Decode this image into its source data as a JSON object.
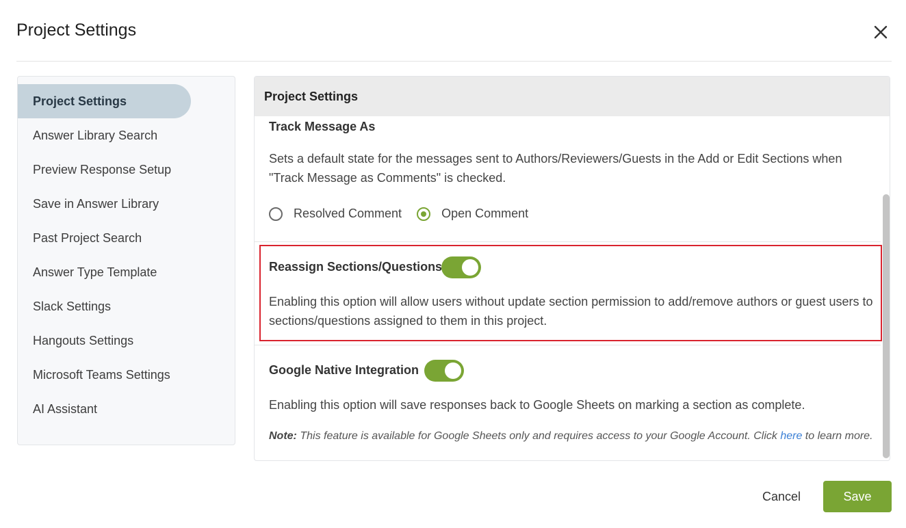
{
  "dialog": {
    "title": "Project Settings",
    "close_icon": "close-icon"
  },
  "sidebar": {
    "items": [
      {
        "label": "Project Settings",
        "active": true
      },
      {
        "label": "Answer Library Search"
      },
      {
        "label": "Preview Response Setup"
      },
      {
        "label": "Save in Answer Library"
      },
      {
        "label": "Past Project Search"
      },
      {
        "label": "Answer Type Template"
      },
      {
        "label": "Slack Settings"
      },
      {
        "label": "Hangouts Settings"
      },
      {
        "label": "Microsoft Teams Settings"
      },
      {
        "label": "AI Assistant"
      }
    ]
  },
  "panel": {
    "header": "Project Settings",
    "track_message": {
      "title": "Track Message As",
      "description": "Sets a default state for the messages sent to Authors/Reviewers/Guests in the Add or Edit Sections when \"Track Message as Comments\" is checked.",
      "options": [
        "Resolved Comment",
        "Open Comment"
      ],
      "selected": "Open Comment"
    },
    "reassign": {
      "title": "Reassign Sections/Questions",
      "enabled": true,
      "description": "Enabling this option will allow users without update section permission to add/remove authors or guest users to sections/questions assigned to them in this project."
    },
    "google": {
      "title": "Google Native Integration",
      "enabled": true,
      "description": "Enabling this option will save responses back to Google Sheets on marking a section as complete.",
      "note_label": "Note:",
      "note_text": " This feature is available for Google Sheets only and requires access to your Google Account. Click ",
      "note_link": "here",
      "note_suffix": " to learn more."
    }
  },
  "footer": {
    "cancel_label": "Cancel",
    "save_label": "Save"
  },
  "colors": {
    "accent": "#7aa534",
    "highlight": "#d9232e",
    "link": "#3a7fd5"
  }
}
